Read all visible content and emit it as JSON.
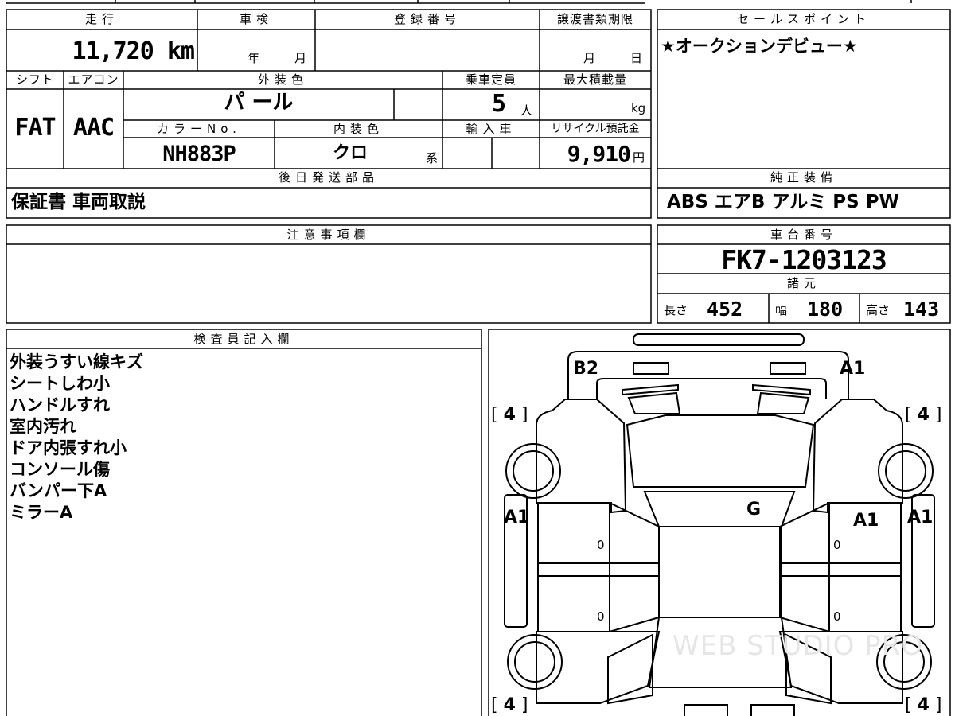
{
  "sheet": {
    "mileage": {
      "header": "走行",
      "value": "11,720 km"
    },
    "inspection": {
      "header": "車検",
      "year_unit": "年",
      "month_unit": "月"
    },
    "registration": {
      "header": "登録番号"
    },
    "transfer_deadline": {
      "header": "譲渡書類期限",
      "month_unit": "月",
      "day_unit": "日"
    },
    "sales_point": {
      "header": "セールスポイント",
      "value": "★オークションデビュー★"
    },
    "shift": {
      "header": "シフト",
      "value": "FAT"
    },
    "aircon": {
      "header": "エアコン",
      "value": "AAC"
    },
    "exterior_color": {
      "header": "外装色",
      "value": "パ ール"
    },
    "capacity": {
      "header": "乗車定員",
      "value": "5",
      "unit": "人"
    },
    "max_load": {
      "header": "最大積載量",
      "unit": "kg"
    },
    "color_no": {
      "header": "カラーNo.",
      "value": "NH883P"
    },
    "interior_color": {
      "header": "内装色",
      "value": "クロ",
      "unit": "系"
    },
    "import": {
      "header": "輸入車"
    },
    "recycle_fee": {
      "header": "リサイクル預託金",
      "value": "9,910",
      "unit": "円"
    },
    "later_items": {
      "header": "後日発送部品",
      "value": "保証書 車両取説"
    },
    "equipment": {
      "header": "純正装備",
      "value": "ABS エアB アルミ PS PW"
    },
    "notes": {
      "header": "注意事項欄"
    },
    "chassis": {
      "header": "車台番号",
      "value": "FK7-1203123"
    },
    "specs": {
      "header": "諸元",
      "length_label": "長さ",
      "length": "452",
      "width_label": "幅",
      "width": "180",
      "height_label": "高さ",
      "height": "143"
    },
    "inspector": {
      "header": "検査員記入欄",
      "lines": [
        "外装うすい線キズ",
        "シートしわ小",
        "ハンドルすれ",
        "室内汚れ",
        "ドア内張すれ小",
        "コンソール傷",
        "バンパー下A",
        "ミラーA"
      ]
    },
    "diagram": {
      "marks": {
        "rear_left": "B2",
        "rear_right": "A1",
        "side_left": "A1",
        "side_right": "A1",
        "roof": "G",
        "right_door": "A1"
      },
      "tires": [
        "4",
        "4",
        "4",
        "4"
      ],
      "door_zeros": [
        "0",
        "0",
        "0",
        "0"
      ],
      "watermark": "WEB STUDIO PRO"
    }
  }
}
